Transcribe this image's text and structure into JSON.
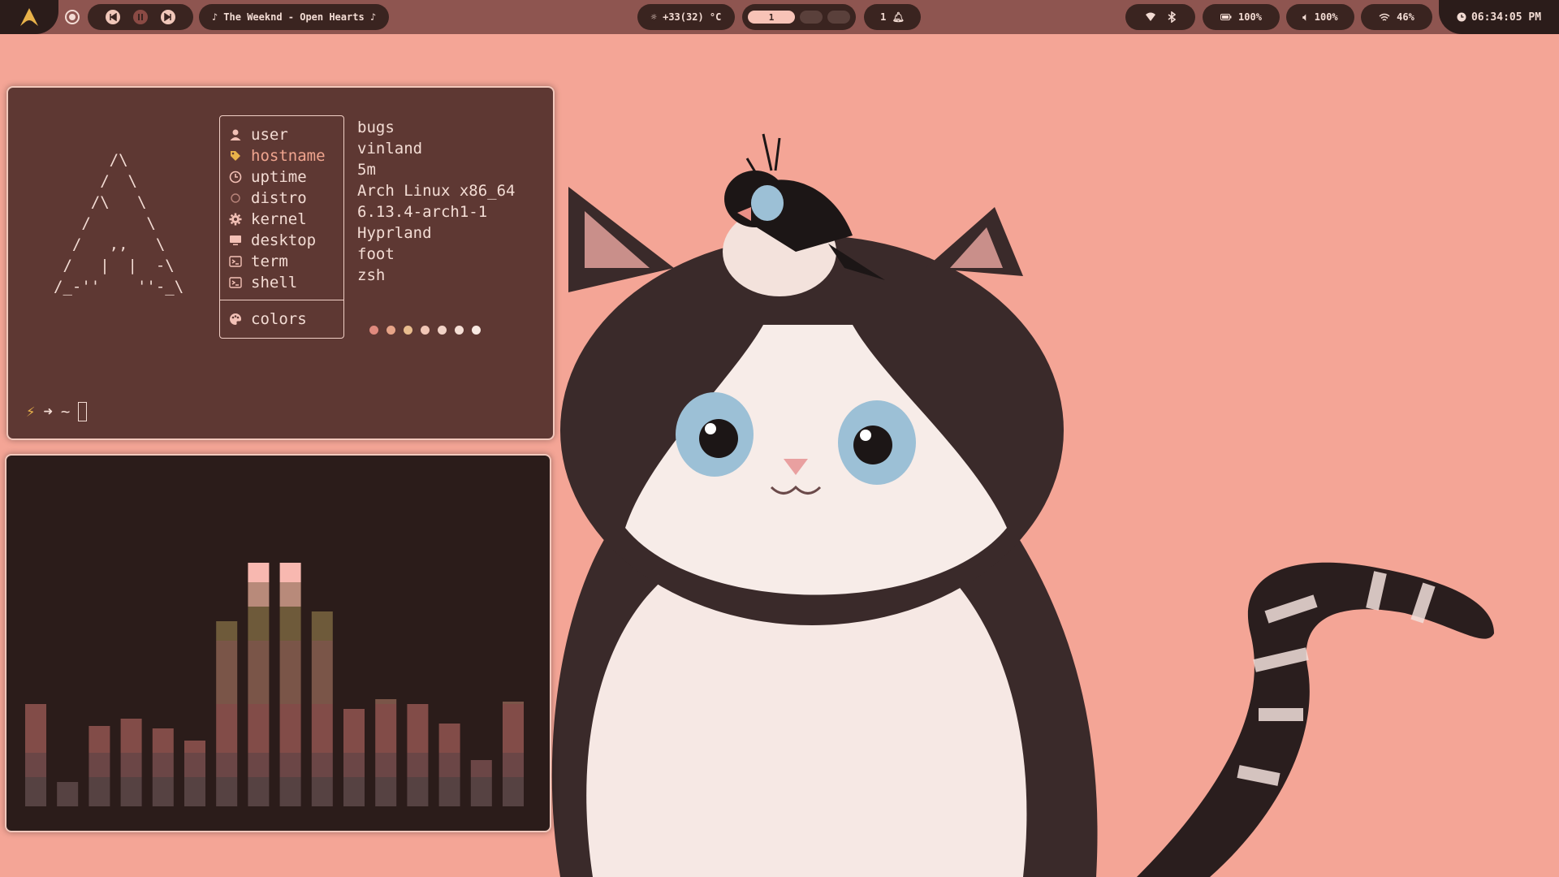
{
  "topbar": {
    "launcher_icon": "arch-logo-icon",
    "media": {
      "now_playing": "♪ The Weeknd - Open Hearts ♪"
    },
    "weather": {
      "text": "☼ +33(32) °C"
    },
    "workspaces": [
      {
        "label": "1",
        "active": true
      },
      {
        "label": "",
        "active": false
      },
      {
        "label": "",
        "active": false
      }
    ],
    "notifications": {
      "text": "1 🔔︎"
    },
    "battery": {
      "text": "100%"
    },
    "volume": {
      "text": "🔈︎ 100%"
    },
    "wifi": {
      "text": "46%"
    },
    "clock": {
      "time": "06:34:05 PM"
    }
  },
  "terminal": {
    "ascii_logo": "      /\\\n     /  \\\n    /\\   \\\n   /      \\\n  /   ,,   \\\n /   |  |  -\\\n/_-''    ''-_\\",
    "info": [
      {
        "key": "user",
        "value": "bugs",
        "icon": "user-icon"
      },
      {
        "key": "hostname",
        "value": "vinland",
        "icon": "tag-icon"
      },
      {
        "key": "uptime",
        "value": "5m",
        "icon": "clock-icon"
      },
      {
        "key": "distro",
        "value": "Arch Linux x86_64",
        "icon": "circle-icon"
      },
      {
        "key": "kernel",
        "value": "6.13.4-arch1-1",
        "icon": "gear-icon"
      },
      {
        "key": "desktop",
        "value": "Hyprland",
        "icon": "monitor-icon"
      },
      {
        "key": "term",
        "value": "foot",
        "icon": "terminal-icon"
      },
      {
        "key": "shell",
        "value": "zsh",
        "icon": "terminal-icon"
      }
    ],
    "colors_label": "colors",
    "color_dots": [
      "#e08a7e",
      "#e7a488",
      "#e9bd8e",
      "#f1c6b6",
      "#f2d3c7",
      "#f5dfd5",
      "#f8e9e2"
    ],
    "prompt": {
      "symbol": "⚡",
      "arrow": "➜",
      "path": "~"
    }
  },
  "visualizer": {
    "bar_levels": [
      0.42,
      0.1,
      0.33,
      0.36,
      0.32,
      0.27,
      0.76,
      1.0,
      1.0,
      0.8,
      0.4,
      0.44,
      0.42,
      0.34,
      0.19,
      0.43
    ]
  },
  "colors": {
    "bar_bg": "#8e5550",
    "pill_bg": "#3a2420",
    "accent": "#f8c3b7",
    "terminal_bg": "#5e3833",
    "wallpaper": "#f4a596"
  }
}
